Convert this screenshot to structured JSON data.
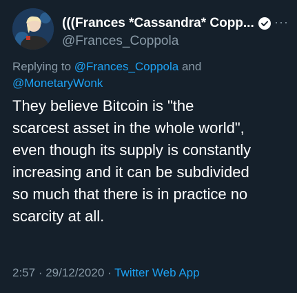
{
  "author": {
    "display_name": "(((Frances *Cassandra* Copp...",
    "handle": "@Frances_Coppola",
    "verified": true
  },
  "more_label": "···",
  "replying": {
    "prefix": "Replying to ",
    "user1": "@Frances_Coppola",
    "joiner": " and",
    "user2": "@MonetaryWonk"
  },
  "tweet": {
    "lines": [
      "They believe Bitcoin is \"the",
      "scarcest asset in the whole world\",",
      "even though its supply is constantly",
      "increasing and it can be subdivided",
      "so much that there is in practice no",
      "scarcity at all."
    ]
  },
  "meta": {
    "time": "2:57",
    "sep1": " · ",
    "date": "29/12/2020",
    "sep2": " · ",
    "source": "Twitter Web App"
  },
  "colors": {
    "background": "#15202b",
    "link": "#1da1f2",
    "muted": "#8899a6"
  },
  "icons": {
    "verified": "verified-badge-icon",
    "more": "more-options-icon"
  }
}
